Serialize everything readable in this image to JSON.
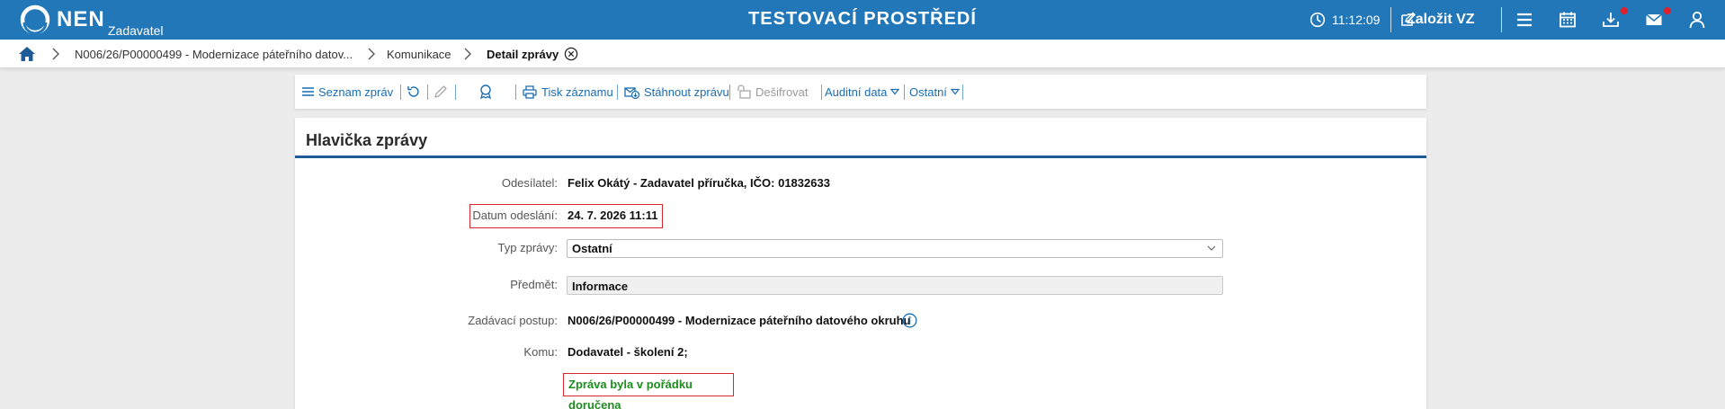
{
  "app": {
    "logo_text": "NEN",
    "logo_sub": "Zadavatel",
    "environment_title": "TESTOVACÍ PROSTŘEDÍ",
    "time": "11:12:09",
    "create_button": "Založit VZ",
    "accent_color": "#2277b8",
    "icons": [
      "clock-icon",
      "edit-icon",
      "menu-icon",
      "calendar-icon",
      "download-icon",
      "mail-icon",
      "user-icon"
    ]
  },
  "breadcrumb": {
    "items": [
      {
        "label": "N006/26/P00000499 - Modernizace páteřního datov..."
      },
      {
        "label": "Komunikace"
      },
      {
        "label": "Detail zprávy"
      }
    ]
  },
  "toolbar": {
    "message_list": "Seznam zpráv",
    "print_record": "Tisk záznamu",
    "download_message": "Stáhnout zprávu",
    "decrypt": "Dešifrovat",
    "audit_data": "Auditní data",
    "other": "Ostatní"
  },
  "header": {
    "title": "Hlavička zprávy",
    "fields": {
      "sender_label": "Odesílatel:",
      "sender_value": "Felix Okátý - Zadavatel příručka, IČO: 01832633",
      "sent_date_label": "Datum odeslání:",
      "sent_date_value": "24. 7. 2026 11:11",
      "type_label": "Typ zprávy:",
      "type_value": "Ostatní",
      "subject_label": "Předmět:",
      "subject_value": "Informace",
      "procedure_label": "Zadávací postup:",
      "procedure_value": "N006/26/P00000499 - Modernizace páteřního datového okruhu",
      "to_label": "Komu:",
      "to_value": "Dodavatel - školení 2;",
      "status": "Zpráva byla v pořádku doručena"
    }
  }
}
